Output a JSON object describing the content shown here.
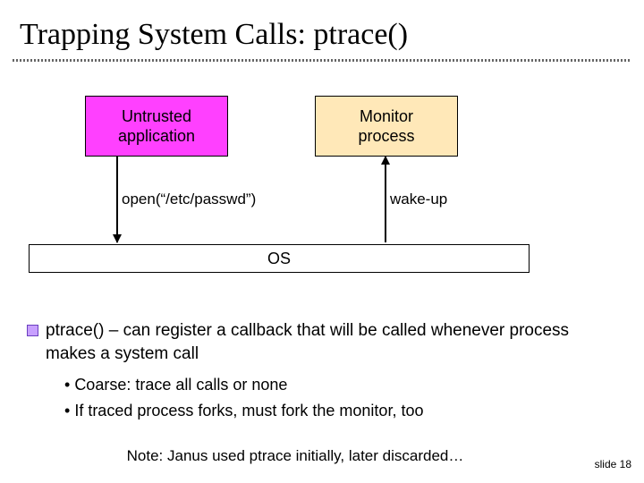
{
  "title": "Trapping System Calls: ptrace()",
  "diagram": {
    "untrusted": {
      "line1": "Untrusted",
      "line2": "application"
    },
    "monitor": {
      "line1": "Monitor",
      "line2": "process"
    },
    "os": "OS",
    "call_label": "open(“/etc/passwd”)",
    "wake_label": "wake-up"
  },
  "main_bullet": "ptrace() – can register a callback that will be called whenever process makes a system call",
  "sub_bullets": [
    "Coarse: trace all calls or none",
    "If traced process forks, must fork the monitor, too"
  ],
  "note": "Note: Janus used ptrace initially, later discarded…",
  "footer": "slide 18"
}
